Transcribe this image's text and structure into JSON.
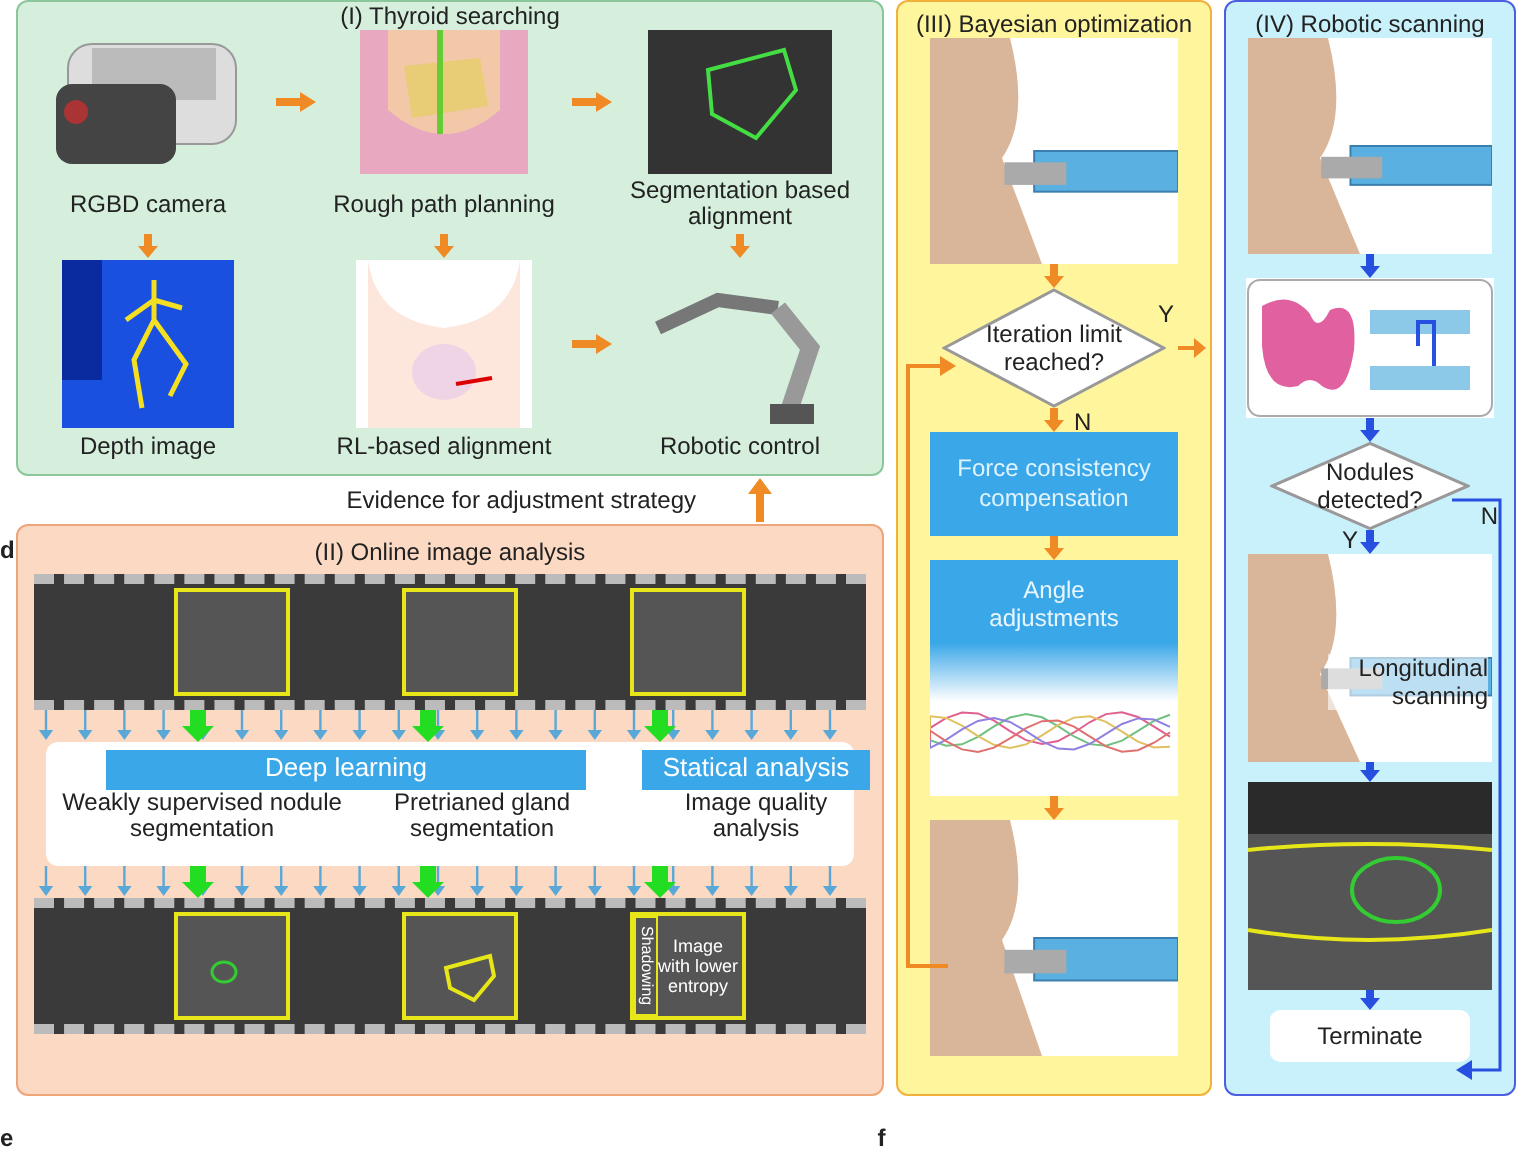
{
  "thyroid_searching": {
    "title": "(I) Thyroid searching",
    "steps": [
      {
        "kind": "camera",
        "caption": "RGBD camera"
      },
      {
        "kind": "neck-photo",
        "caption": "Rough path planning"
      },
      {
        "kind": "ultrasound",
        "caption": "Segmentation based alignment"
      },
      {
        "kind": "depth",
        "caption": "Depth image"
      },
      {
        "kind": "neck-drawing",
        "caption": "RL-based alignment"
      },
      {
        "kind": "robot",
        "caption": "Robotic control"
      }
    ]
  },
  "evidence_label": "Evidence for adjustment strategy",
  "online_image_analysis": {
    "panel_letter": "d",
    "title": "(II) Online image analysis",
    "methods": [
      {
        "label": "Deep learning"
      },
      {
        "label": "Statical analysis"
      }
    ],
    "tasks": [
      {
        "label": "Weakly supervised nodule segmentation"
      },
      {
        "label": "Pretrianed gland segmentation"
      },
      {
        "label": "Image quality analysis"
      }
    ],
    "annotations": [
      {
        "label": "Shadowing"
      },
      {
        "label": "Image with lower entropy"
      }
    ]
  },
  "bayesian_optimization": {
    "title": "(III) Bayesian optimization",
    "decision": "Iteration limit reached?",
    "yes": "Y",
    "no": "N",
    "steps": [
      {
        "label": "Force consistency compensation"
      },
      {
        "label": "Angle adjustments"
      }
    ]
  },
  "robotic_scanning": {
    "title": "(IV) Robotic scanning",
    "decision": "Nodules detected?",
    "yes": "Y",
    "no": "N",
    "caption": "Longitudinal scanning",
    "end": "Terminate"
  },
  "bottom_panel_letters": [
    {
      "letter": "e"
    },
    {
      "letter": "f"
    }
  ]
}
